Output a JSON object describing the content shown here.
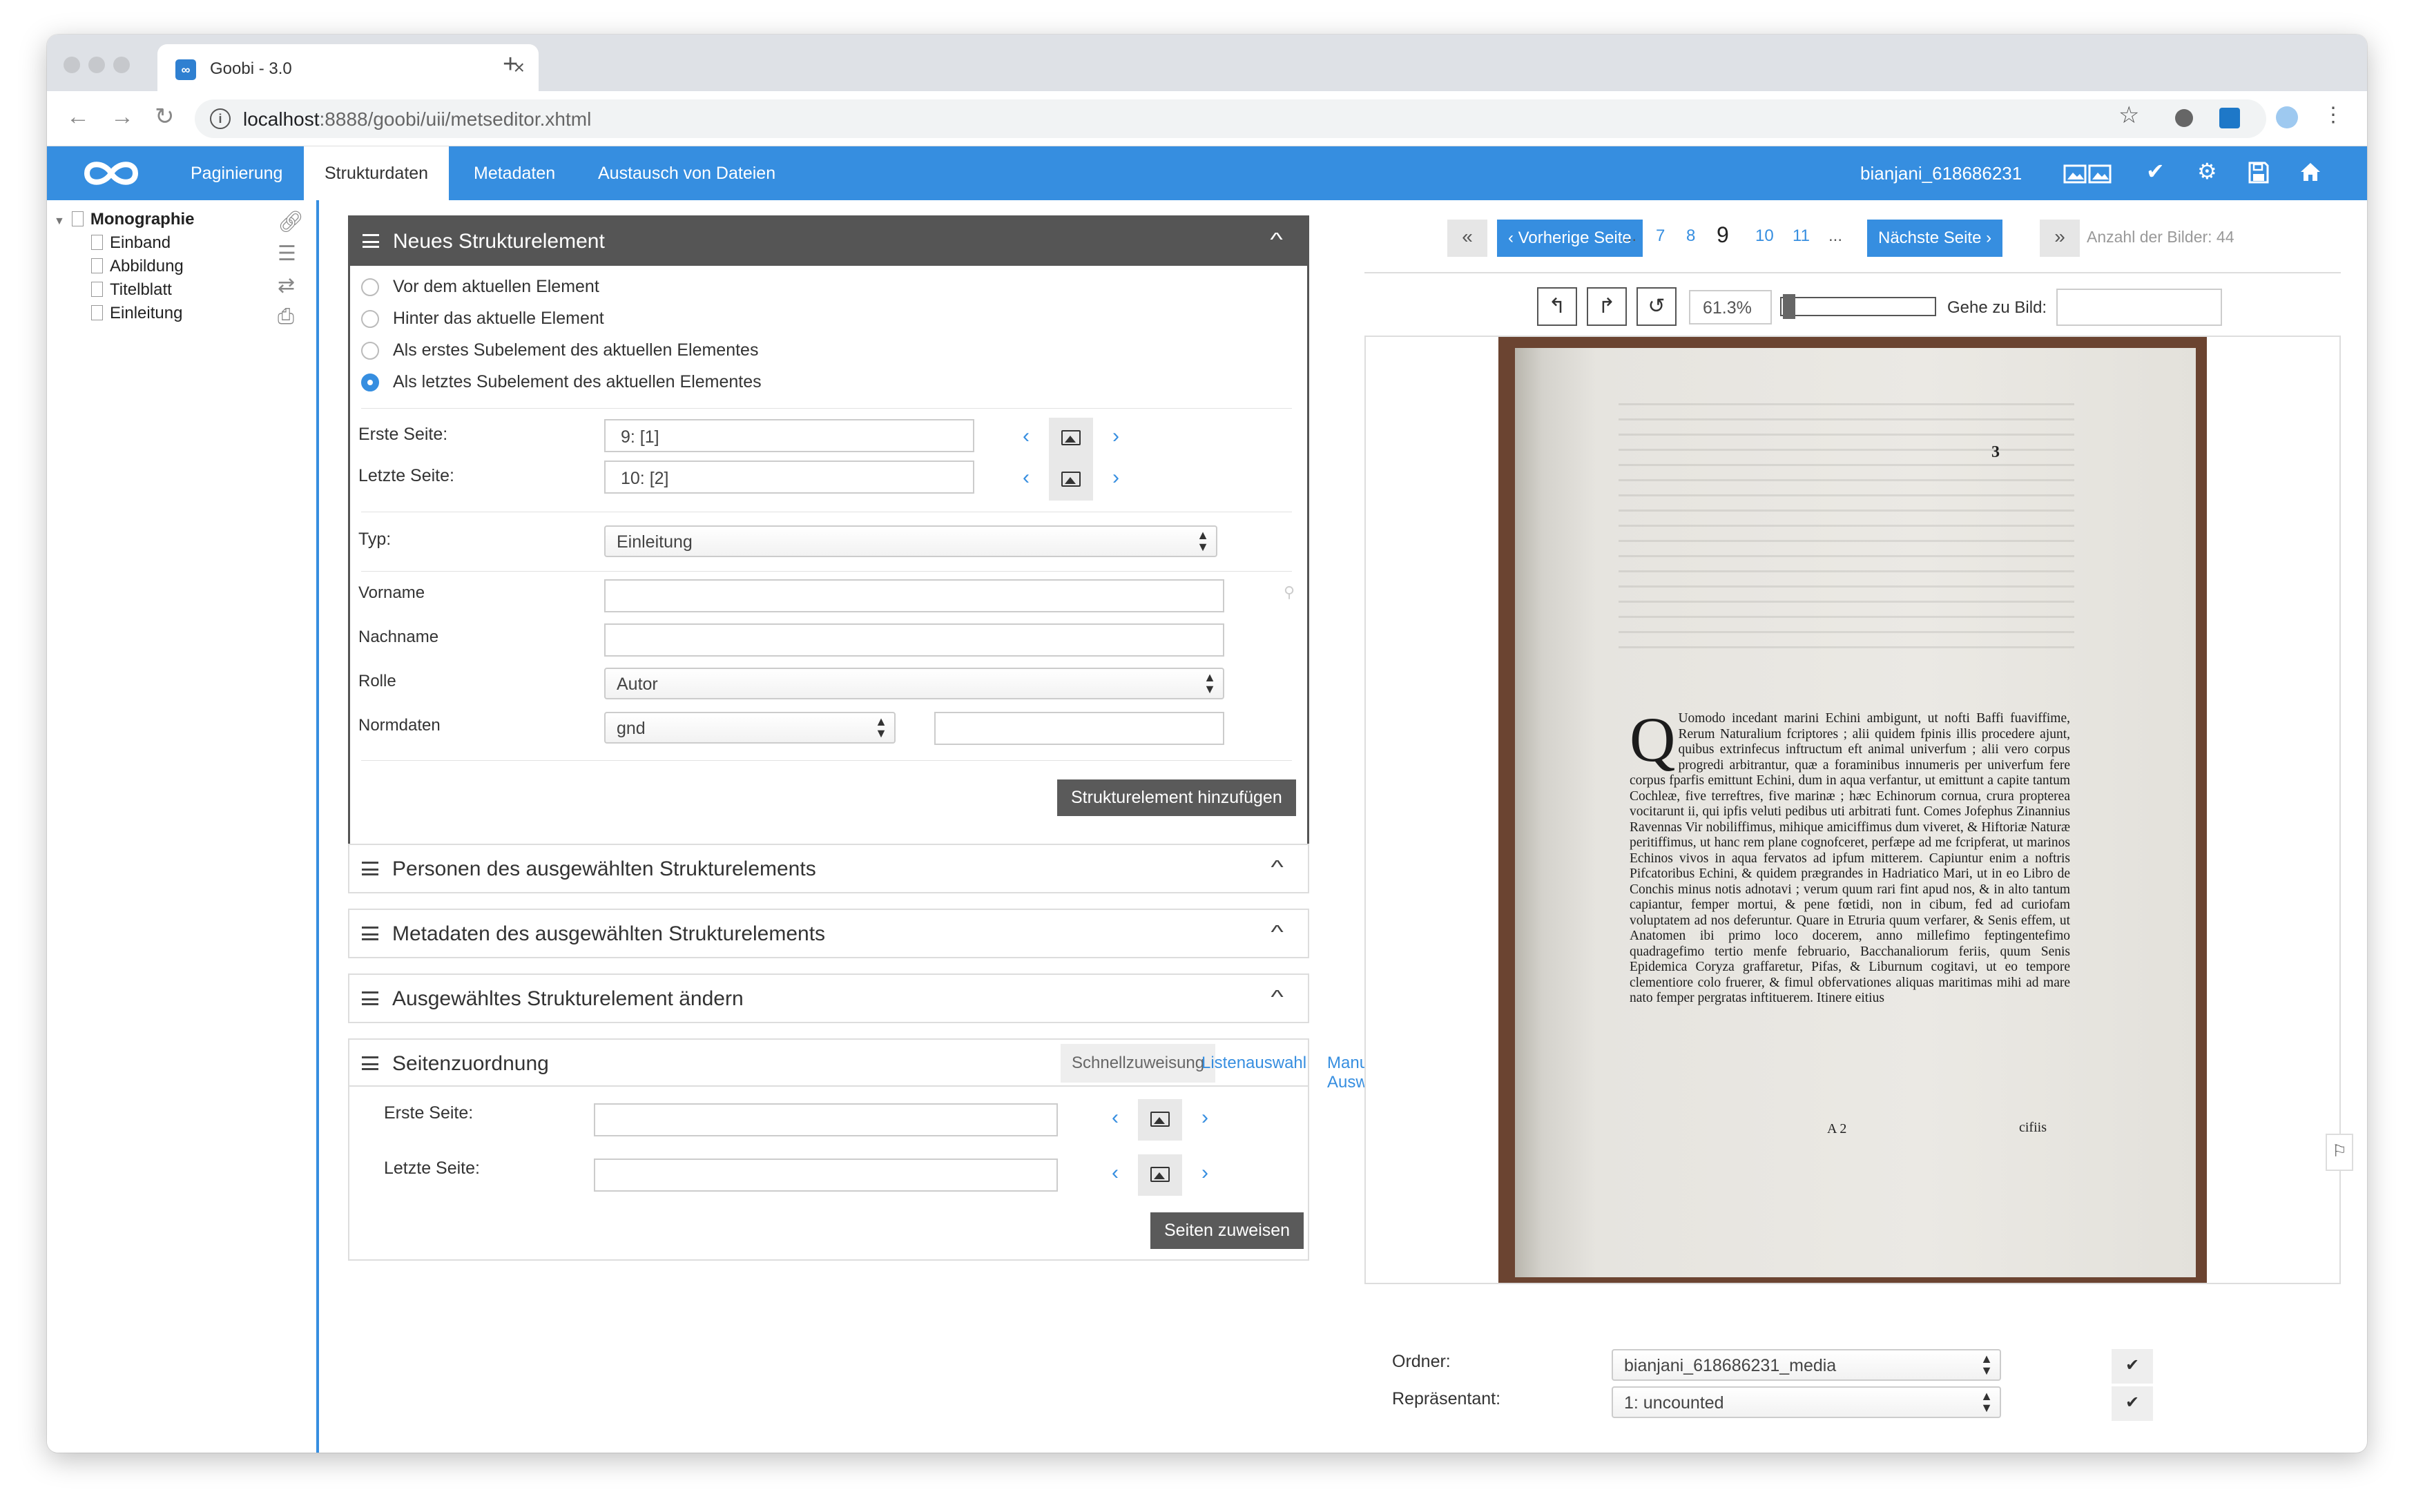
{
  "browser": {
    "tab_title": "Goobi - 3.0",
    "url_host": "localhost",
    "url_rest": ":8888/goobi/uii/metseditor.xhtml"
  },
  "app": {
    "tabs": [
      "Paginierung",
      "Strukturdaten",
      "Metadaten",
      "Austausch von Dateien"
    ],
    "active_tab": "Strukturdaten",
    "record_id": "bianjani_618686231",
    "accent_color": "#368ee0"
  },
  "tree": {
    "root": "Monographie",
    "children": [
      "Einband",
      "Abbildung",
      "Titelblatt",
      "Einleitung"
    ]
  },
  "new_element": {
    "title": "Neues Strukturelement",
    "options": [
      "Vor dem aktuellen Element",
      "Hinter das aktuelle Element",
      "Als erstes Subelement des aktuellen Elementes",
      "Als letztes Subelement des aktuellen Elementes"
    ],
    "selected_option": 3,
    "first_page_label": "Erste Seite:",
    "first_page_value": "9: [1]",
    "last_page_label": "Letzte Seite:",
    "last_page_value": "10: [2]",
    "type_label": "Typ:",
    "type_value": "Einleitung",
    "firstname_label": "Vorname",
    "lastname_label": "Nachname",
    "role_label": "Rolle",
    "role_value": "Autor",
    "authority_label": "Normdaten",
    "authority_value": "gnd",
    "add_button": "Strukturelement hinzufügen"
  },
  "collapsed_panels": [
    "Personen des ausgewählten Strukturelements",
    "Metadaten des ausgewählten Strukturelements",
    "Ausgewähltes Strukturelement ändern"
  ],
  "page_assign": {
    "title": "Seitenzuordnung",
    "tabs": [
      "Schnellzuweisung",
      "Listenauswahl",
      "Manuelle Auswahl"
    ],
    "active_tab": "Schnellzuweisung",
    "first_page_label": "Erste Seite:",
    "last_page_label": "Letzte Seite:",
    "assign_button": "Seiten zuweisen"
  },
  "viewer": {
    "prev_label": "Vorherige Seite",
    "next_label": "Nächste Seite",
    "ellipsis": "...",
    "pages_before": [
      "7",
      "8"
    ],
    "current_page": "9",
    "pages_after": [
      "10",
      "11"
    ],
    "image_count": "Anzahl der Bilder: 44",
    "zoom": "61.3%",
    "goto_label": "Gehe zu Bild:",
    "page_number_printed": "3",
    "scan_text": "Uomodo incedant marini Echini ambigunt, ut nofti Baffi fuaviffime, Rerum Naturalium fcriptores ; alii quidem fpinis illis procedere ajunt, quibus extrinfecus inftructum eft animal univerfum ; alii vero corpus progredi arbitrantur, quæ a foraminibus innumeris per univerfum fere corpus fparfis emittunt Echini, dum in aqua verfantur, ut emittunt a capite tantum Cochleæ, five terreftres, five marinæ ; hæc Echinorum cornua, crura propterea vocitarunt ii, qui ipfis veluti pedibus uti arbitrati funt. Comes Jofephus Zinannius Ravennas Vir nobiliffimus, mihique amiciffimus dum viveret, & Hiftoriæ Naturæ peritiffimus, ut hanc rem plane cognofceret, perfæpe ad me fcripferat, ut marinos Echinos vivos in aqua fervatos ad ipfum mitterem. Capiuntur enim a noftris Pifcatoribus Echini, & quidem prægrandes in Hadriatico Mari, ut in eo Libro de Conchis minus notis adnotavi ; verum quum rari fint apud nos, & in alto tantum capiantur, femper mortui, & pene fœtidi, non in cibum, fed ad curiofam voluptatem ad nos deferuntur. Quare in Etruria quum verfarer, & Senis effem, ut Anatomen ibi primo loco docerem, anno millefimo feptingentefimo quadragefimo tertio menfe februario, Bacchanaliorum feriis, quum Senis Epidemica Coryza graffaretur, Pifas, & Liburnum cogitavi, ut eo tempore clementiore colo fruerer, & fimul obfervationes aliquas maritimas mihi ad mare nato femper pergratas inftituerem. Itinere eitius",
    "signature_mark": "A 2",
    "catchword": "cifiis",
    "folder_label": "Ordner:",
    "folder_value": "bianjani_618686231_media",
    "representative_label": "Repräsentant:",
    "representative_value": "1: uncounted"
  }
}
